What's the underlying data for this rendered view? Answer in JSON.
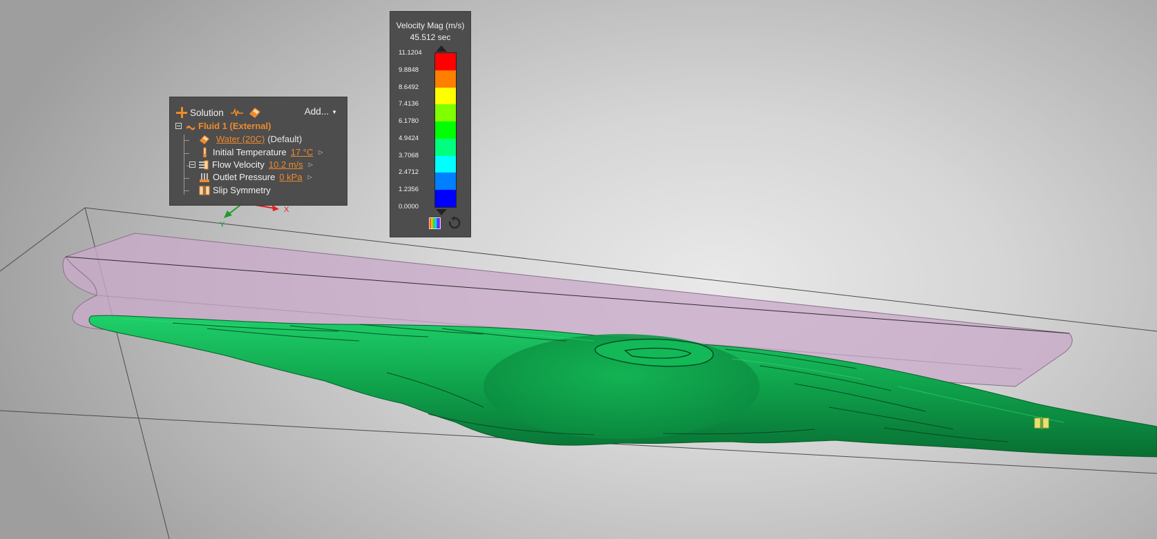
{
  "solution_panel": {
    "header_label": "Solution",
    "add_label": "Add...",
    "fluid": {
      "name": "Fluid 1 (External)",
      "material": "Water (20C)",
      "material_note": "(Default)",
      "initial_temperature": {
        "label": "Initial Temperature",
        "value": "17 °C"
      },
      "flow_velocity": {
        "label": "Flow Velocity",
        "value": "10.2 m/s"
      },
      "outlet_pressure": {
        "label": "Outlet Pressure",
        "value": "0 kPa"
      },
      "slip_symmetry": {
        "label": "Slip Symmetry"
      }
    }
  },
  "legend": {
    "title": "Velocity Mag (m/s)",
    "time": "45.512 sec",
    "ticks": [
      "11.1204",
      "9.8848",
      "8.6492",
      "7.4136",
      "6.1780",
      "4.9424",
      "3.7068",
      "2.4712",
      "1.2356",
      "0.0000"
    ],
    "colors": [
      "#ff0000",
      "#ff7f00",
      "#ffff00",
      "#7fff00",
      "#00ff00",
      "#00ff7f",
      "#00ffff",
      "#0080ff",
      "#0000ff"
    ]
  },
  "axis_labels": {
    "x": "X",
    "y": "Y"
  },
  "icons": {
    "add": "plus-icon",
    "signal": "pulse-icon",
    "material": "eraser-material-icon",
    "fluid": "fluid-icon",
    "temperature": "thermometer-icon",
    "flow": "flow-inlet-icon",
    "pressure": "pressure-icon",
    "symmetry": "slip-symmetry-icon",
    "palette": "color-palette-icon",
    "reset": "reset-icon"
  },
  "scene_colors": {
    "isosurface": "#0ea24a",
    "body": "#c7a8c7",
    "accent": "#f08a2c"
  }
}
